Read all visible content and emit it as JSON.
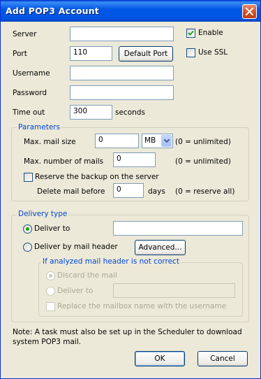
{
  "window": {
    "title": "Add POP3 Account",
    "close_icon": "close-icon"
  },
  "server": {
    "label": "Server",
    "value": ""
  },
  "enable": {
    "label": "Enable",
    "checked": true
  },
  "port": {
    "label": "Port",
    "value": "110",
    "default_button": "Default Port"
  },
  "use_ssl": {
    "label": "Use SSL",
    "checked": false
  },
  "username": {
    "label": "Username",
    "value": ""
  },
  "password": {
    "label": "Password",
    "value": ""
  },
  "timeout": {
    "label": "Time out",
    "value": "300",
    "unit": "seconds"
  },
  "parameters": {
    "legend": "Parameters",
    "max_mail_size": {
      "label": "Max. mail size",
      "value": "0",
      "unit": "MB",
      "note": "(0 = unlimited)"
    },
    "max_number_mails": {
      "label": "Max. number of mails",
      "value": "0",
      "note": "(0 = unlimited)"
    },
    "reserve_backup": {
      "label": "Reserve the backup on the server",
      "checked": false
    },
    "delete_before": {
      "label": "Delete mail before",
      "value": "0",
      "unit": "days",
      "note": "(0 = reserve all)"
    }
  },
  "delivery": {
    "legend": "Delivery type",
    "deliver_to": {
      "label": "Deliver to",
      "selected": true,
      "value": ""
    },
    "deliver_by_header": {
      "label": "Deliver by mail header",
      "selected": false,
      "advanced_button": "Advanced..."
    },
    "incorrect": {
      "legend": "If analyzed mail header is not correct",
      "discard": {
        "label": "Discard the mail",
        "selected": true
      },
      "deliver_to": {
        "label": "Deliver to",
        "selected": false,
        "value": ""
      },
      "replace": {
        "label": "Replace the mailbox name with the username",
        "checked": false
      }
    }
  },
  "note": "Note: A task must also be set up in the Scheduler to download system POP3 mail.",
  "buttons": {
    "ok": "OK",
    "cancel": "Cancel"
  },
  "colors": {
    "title_bar": "#0054e3",
    "group_legend": "#0046d5",
    "dialog_bg": "#ece9d8"
  }
}
